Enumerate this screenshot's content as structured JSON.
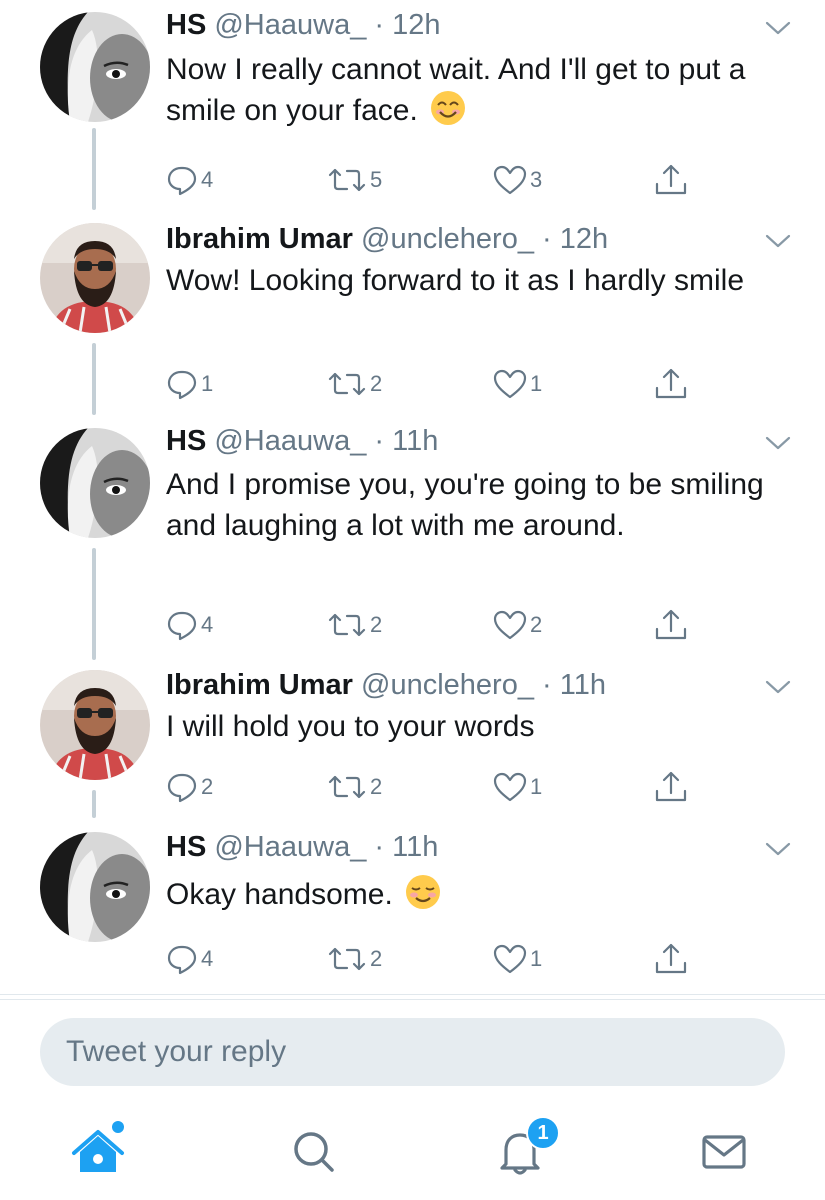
{
  "tweets": [
    {
      "name": "HS",
      "handle": "@Haauwa_",
      "time": "12h",
      "text": "Now I really cannot wait. And I'll get to put a smile on your face.",
      "emoji": "smiling-face-with-smiling-eyes",
      "replies": "4",
      "retweets": "5",
      "likes": "3",
      "avatar": "hs-avatar"
    },
    {
      "name": "Ibrahim Umar",
      "handle": "@unclehero_",
      "time": "12h",
      "text": "Wow! Looking forward to it as I hardly smile",
      "replies": "1",
      "retweets": "2",
      "likes": "1",
      "avatar": "ibrahim-avatar"
    },
    {
      "name": "HS",
      "handle": "@Haauwa_",
      "time": "11h",
      "text": "And I promise you, you're going to be smiling and laughing a lot with me around.",
      "replies": "4",
      "retweets": "2",
      "likes": "2",
      "avatar": "hs-avatar"
    },
    {
      "name": "Ibrahim Umar",
      "handle": "@unclehero_",
      "time": "11h",
      "text": "I will hold you to your words",
      "replies": "2",
      "retweets": "2",
      "likes": "1",
      "avatar": "ibrahim-avatar"
    },
    {
      "name": "HS",
      "handle": "@Haauwa_",
      "time": "11h",
      "text": "Okay handsome.",
      "emoji": "smiling-face",
      "replies": "4",
      "retweets": "2",
      "likes": "1",
      "avatar": "hs-avatar"
    }
  ],
  "separator": " · ",
  "reply_box": {
    "placeholder": "Tweet your reply"
  },
  "navbar": {
    "items": [
      "home-icon",
      "search-icon",
      "notifications-icon",
      "messages-icon"
    ],
    "notifications_badge": "1"
  },
  "colors": {
    "accent": "#1da1f2",
    "muted": "#657786",
    "text": "#14171a",
    "thread_line": "#c4cfd6"
  }
}
